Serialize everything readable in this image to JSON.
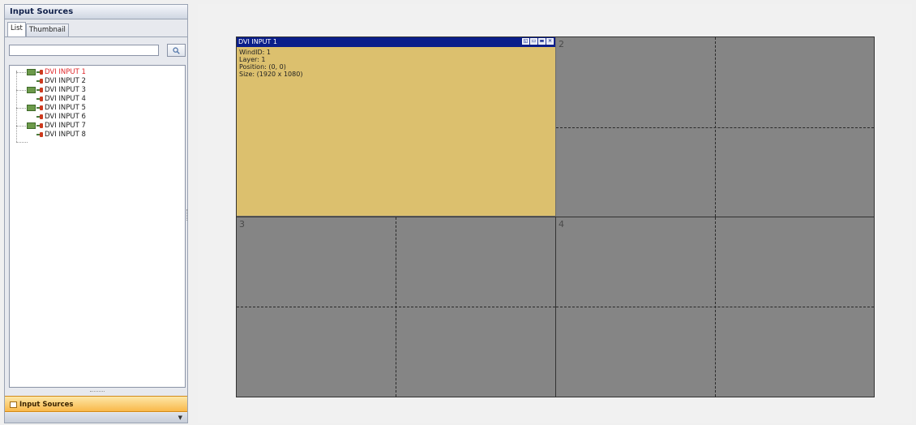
{
  "left_panel": {
    "title": "Input Sources",
    "tabs": [
      {
        "label": "List",
        "active": true
      },
      {
        "label": "Thumbnail",
        "active": false
      }
    ],
    "search": {
      "value": "",
      "placeholder": "",
      "icon": "search-icon"
    },
    "tree_items": [
      {
        "label": "DVI INPUT 1",
        "selected": true,
        "icon": "monitor-plug-icon"
      },
      {
        "label": "DVI INPUT 2",
        "selected": false,
        "icon": "plug-icon"
      },
      {
        "label": "DVI INPUT 3",
        "selected": false,
        "icon": "monitor-plug-icon"
      },
      {
        "label": "DVI INPUT 4",
        "selected": false,
        "icon": "plug-icon"
      },
      {
        "label": "DVI INPUT 5",
        "selected": false,
        "icon": "monitor-plug-icon"
      },
      {
        "label": "DVI INPUT 6",
        "selected": false,
        "icon": "plug-icon"
      },
      {
        "label": "DVI INPUT 7",
        "selected": false,
        "icon": "monitor-plug-icon"
      },
      {
        "label": "DVI INPUT 8",
        "selected": false,
        "icon": "plug-icon"
      }
    ],
    "bottom_tab": {
      "label": "Input Sources",
      "icon": "home-icon"
    },
    "expand_icon": "arrow-down-icon"
  },
  "wall": {
    "screen_labels": [
      "2",
      "3",
      "4"
    ],
    "window": {
      "title": "DVI INPUT 1",
      "info_lines": [
        "WindID: 1",
        "Layer: 1",
        "Position: (0, 0)",
        "Size: (1920 x 1080)"
      ],
      "buttons": [
        "restore-icon",
        "minimize-icon",
        "maximize-icon",
        "close-icon"
      ]
    }
  },
  "colors": {
    "window_title_bg": "#0a1e8a",
    "window_bg": "#dcc06e",
    "wall_bg": "#858585",
    "selected_item": "#e0282b",
    "bottom_tab_bg": "#f9b84a"
  }
}
